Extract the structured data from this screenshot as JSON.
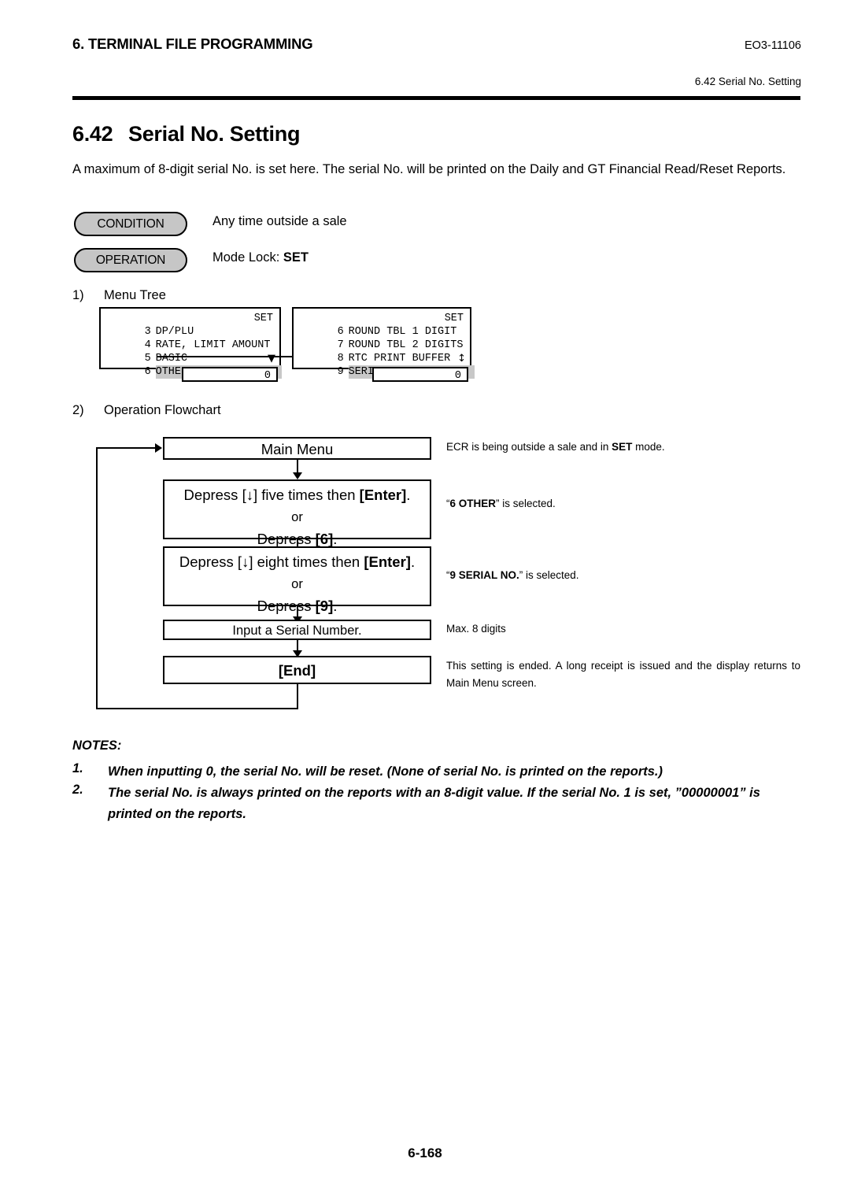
{
  "header": {
    "section_title": "6. TERMINAL FILE PROGRAMMING",
    "doc_code": "EO3-11106",
    "running_head": "6.42 Serial No. Setting"
  },
  "section": {
    "number": "6.42",
    "name": "Serial No. Setting",
    "intro": "A maximum of 8-digit serial No. is set here.  The serial No. will be printed on the Daily and GT Financial Read/Reset Reports."
  },
  "labels": {
    "condition": "CONDITION",
    "condition_value": "Any time outside a sale",
    "operation": "OPERATION",
    "operation_value_prefix": "Mode Lock: ",
    "operation_value_bold": "SET"
  },
  "subsections": {
    "menu_tree_num": "1)",
    "menu_tree_title": "Menu Tree",
    "flowchart_num": "2)",
    "flowchart_title": "Operation Flowchart"
  },
  "menu_tree": {
    "left_screen": {
      "rows": [
        {
          "index": "3",
          "label": "DP/PLU",
          "right": "SET",
          "highlight": false
        },
        {
          "index": "4",
          "label": "RATE, LIMIT AMOUNT",
          "right": "",
          "highlight": false
        },
        {
          "index": "5",
          "label": "BASIC",
          "right": "",
          "highlight": false
        },
        {
          "index": "6",
          "label": "OTHER",
          "right": "",
          "highlight": true
        }
      ],
      "scroll_arrow": "▼",
      "footer_value": "0"
    },
    "right_screen": {
      "rows": [
        {
          "index": "6",
          "label": "ROUND TBL 1 DIGIT",
          "right": "SET",
          "highlight": false
        },
        {
          "index": "7",
          "label": "ROUND TBL 2 DIGITS",
          "right": "",
          "highlight": false
        },
        {
          "index": "8",
          "label": "RTC PRINT BUFFER",
          "right": "",
          "highlight": false
        },
        {
          "index": "9",
          "label": "SERIAL NO.",
          "right": "",
          "highlight": true
        }
      ],
      "scroll_arrow": "↕",
      "footer_value": "0"
    }
  },
  "flowchart": {
    "steps": [
      {
        "id": "main-menu",
        "lines": [
          "Main Menu"
        ],
        "note_html": "ECR is being outside a sale and in <b>SET</b> mode."
      },
      {
        "id": "depress-six",
        "lines": [
          "Depress [↓] five times then [Enter].",
          "or",
          "Depress [6]."
        ],
        "note_html": "“<b>6 OTHER</b>” is selected."
      },
      {
        "id": "depress-nine",
        "lines": [
          "Depress [↓] eight times then [Enter].",
          "or",
          "Depress [9]."
        ],
        "note_html": "“<b>9 SERIAL NO.</b>” is selected."
      },
      {
        "id": "input-serial",
        "lines": [
          "Input a Serial Number."
        ],
        "note_html": "Max. 8 digits"
      },
      {
        "id": "end",
        "lines": [
          "[End]"
        ],
        "note_html": "This setting is ended.  A long receipt is issued and the display returns to Main Menu screen."
      }
    ],
    "step1_line1_a": "Depress [",
    "step1_line1_key": "↓",
    "step1_line1_b": "] five times then ",
    "step1_line1_enter": "[Enter]",
    "step1_line1_c": ".",
    "step1_line2": "or",
    "step1_line3_a": "Depress ",
    "step1_line3_key": "[6]",
    "step1_line3_b": ".",
    "step2_line1_a": "Depress [",
    "step2_line1_key": "↓",
    "step2_line1_b": "] eight times then ",
    "step2_line1_enter": "[Enter]",
    "step2_line1_c": ".",
    "step2_line2": "or",
    "step2_line3_a": "Depress ",
    "step2_line3_key": "[9]",
    "step2_line3_b": ".",
    "main_menu_label": "Main Menu",
    "input_serial_label": "Input a Serial Number.",
    "end_label": "[End]",
    "note_main_menu_a": "ECR is being outside a sale and in ",
    "note_main_menu_bold": "SET",
    "note_main_menu_b": " mode.",
    "note_six_a": "“",
    "note_six_bold": "6 OTHER",
    "note_six_b": "” is selected.",
    "note_nine_a": "“",
    "note_nine_bold": "9 SERIAL NO.",
    "note_nine_b": "” is selected.",
    "note_input": "Max. 8 digits",
    "note_end": "This setting is ended.  A long receipt is issued and the display returns to Main Menu screen."
  },
  "notes": {
    "title": "NOTES:",
    "items": [
      {
        "num": "1.",
        "text": "When inputting 0, the serial No. will be reset.  (None of serial No. is printed on the reports.)"
      },
      {
        "num": "2.",
        "text": "The serial No. is always printed on the reports with an 8-digit value.  If the serial No. 1 is set, ”00000001” is printed on the reports."
      }
    ]
  },
  "footer": {
    "page": "6-168"
  }
}
